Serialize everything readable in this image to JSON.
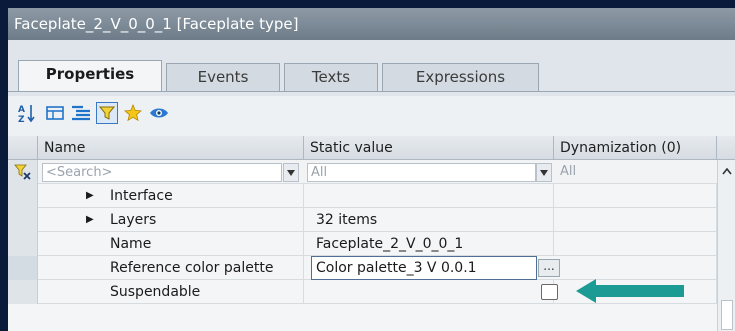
{
  "window": {
    "title": "Faceplate_2_V_0_0_1 [Faceplate type]"
  },
  "tabs": [
    {
      "label": "Properties",
      "active": true
    },
    {
      "label": "Events",
      "active": false
    },
    {
      "label": "Texts",
      "active": false
    },
    {
      "label": "Expressions",
      "active": false
    }
  ],
  "toolbar": {
    "icons": [
      "sort-az-icon",
      "group-icon",
      "list-icon",
      "filter-icon",
      "favorite-star-icon",
      "eye-icon"
    ],
    "selected": "filter-icon"
  },
  "grid": {
    "columns": {
      "name": "Name",
      "static_value": "Static value",
      "dynamization": "Dynamization (0)"
    },
    "filter": {
      "name_placeholder": "<Search>",
      "static_value": "All",
      "dynamization": "All"
    },
    "rows": [
      {
        "name": "Interface",
        "value": "",
        "expandable": true
      },
      {
        "name": "Layers",
        "value": "32 items",
        "expandable": true
      },
      {
        "name": "Name",
        "value": "Faceplate_2_V_0_0_1",
        "expandable": false
      },
      {
        "name": "Reference color palette",
        "value": "Color palette_3 V 0.0.1",
        "expandable": false,
        "editing": true
      },
      {
        "name": "Suspendable",
        "value": "",
        "expandable": false,
        "checkbox": false
      }
    ],
    "ellipsis_label": "..."
  },
  "colors": {
    "title_bar": "#7b8996",
    "arrow": "#1c9a94",
    "background": "#0a1a3a"
  }
}
